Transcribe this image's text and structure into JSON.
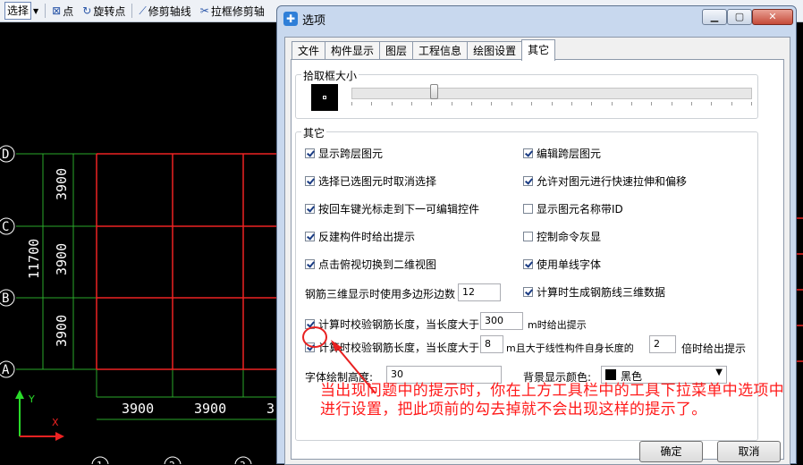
{
  "cad": {
    "toolbar": {
      "select_label": "选择",
      "point_label": "点",
      "rotate_point_label": "旋转点",
      "trim_axis_label": "修剪轴线",
      "box_trim_label": "拉框修剪轴"
    },
    "axis_labels": [
      "D",
      "C",
      "B",
      "A"
    ],
    "bottom_axis_labels": [
      "1",
      "2",
      "3"
    ],
    "dims": {
      "left_span_1": "3900",
      "left_span_2": "3900",
      "left_span_3": "3900",
      "left_total": "11700",
      "bottom_span_1": "3900",
      "bottom_span_2": "3900",
      "bottom_span_3": "3"
    },
    "ucs": {
      "y_label": "Y",
      "x_label": "X"
    }
  },
  "dialog": {
    "title": "选项",
    "tabs": [
      {
        "label": "文件",
        "active": false
      },
      {
        "label": "构件显示",
        "active": false
      },
      {
        "label": "图层",
        "active": false
      },
      {
        "label": "工程信息",
        "active": false
      },
      {
        "label": "绘图设置",
        "active": false
      },
      {
        "label": "其它",
        "active": true
      }
    ],
    "pick_box": {
      "legend": "拾取框大小",
      "slider_value_fraction": 0.2
    },
    "other": {
      "legend": "其它",
      "checks_left": [
        {
          "label": "显示跨层图元",
          "checked": true
        },
        {
          "label": "选择已选图元时取消选择",
          "checked": true
        },
        {
          "label": "按回车键光标走到下一可编辑控件",
          "checked": true
        },
        {
          "label": "反建构件时给出提示",
          "checked": true
        },
        {
          "label": "点击俯视切换到二维视图",
          "checked": true
        }
      ],
      "checks_right": [
        {
          "label": "编辑跨层图元",
          "checked": true
        },
        {
          "label": "允许对图元进行快速拉伸和偏移",
          "checked": true
        },
        {
          "label": "显示图元名称带ID",
          "checked": false
        },
        {
          "label": "控制命令灰显",
          "checked": false
        },
        {
          "label": "使用单线字体",
          "checked": true
        },
        {
          "label": "计算时生成钢筋线三维数据",
          "checked": true
        }
      ],
      "polygon_label": "钢筋三维显示时使用多边形边数",
      "polygon_value": "12",
      "check_length": {
        "prefix": "计算时校验钢筋长度，当长度大于",
        "value": "300",
        "suffix": "m时给出提示",
        "checked": true
      },
      "check_ratio": {
        "prefix": "计算时校验钢筋长度，当长度大于",
        "value": "8",
        "middle": "m且大于线性构件自身长度的",
        "ratio_value": "2",
        "suffix": "倍时给出提示",
        "checked": true
      },
      "font_height_label": "字体绘制高度:",
      "font_height_value": "30",
      "bg_color_label": "背景显示颜色:",
      "bg_color_value": "黑色"
    },
    "ok_label": "确定",
    "cancel_label": "取消"
  },
  "annotation": {
    "text": "当出现问题中的提示时，你在上方工具栏中的工具下拉菜单中选项中进行设置，把此项前的勾去掉就不会出现这样的提示了。",
    "color": "#ff1a1a"
  }
}
